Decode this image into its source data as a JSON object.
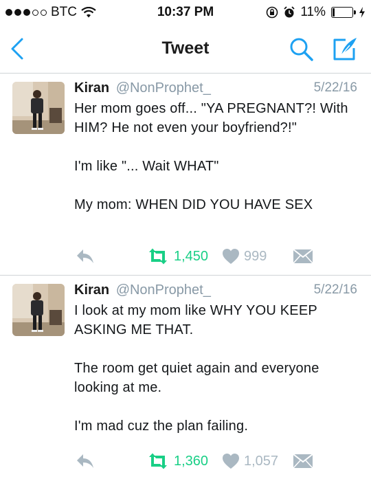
{
  "status_bar": {
    "carrier": "BTC",
    "time": "10:37 PM",
    "battery": "11%",
    "battery_level": 0.11
  },
  "nav": {
    "title": "Tweet",
    "icons": [
      "chevron-left-icon",
      "search-icon",
      "compose-icon"
    ]
  },
  "tweets": [
    {
      "name": "Kiran",
      "handle": "@NonProphet_",
      "date": "5/22/16",
      "paragraphs": [
        "Her mom goes off... \"YA PREGNANT?! With HIM? He not even your boyfriend?!\"",
        "I'm like \"... Wait WHAT\"",
        "My mom: WHEN DID YOU HAVE SEX"
      ],
      "retweets": "1,450",
      "likes": "999"
    },
    {
      "name": "Kiran",
      "handle": "@NonProphet_",
      "date": "5/22/16",
      "paragraphs": [
        "I look at my mom like WHY YOU KEEP ASKING ME THAT.",
        "The room get quiet again and everyone looking at me.",
        "I'm mad cuz the plan failing."
      ],
      "retweets": "1,360",
      "likes": "1,057"
    }
  ],
  "colors": {
    "accent": "#1da1f2",
    "retweet": "#19cf86",
    "muted": "#aab8c2",
    "divider": "#cfd3d6"
  }
}
